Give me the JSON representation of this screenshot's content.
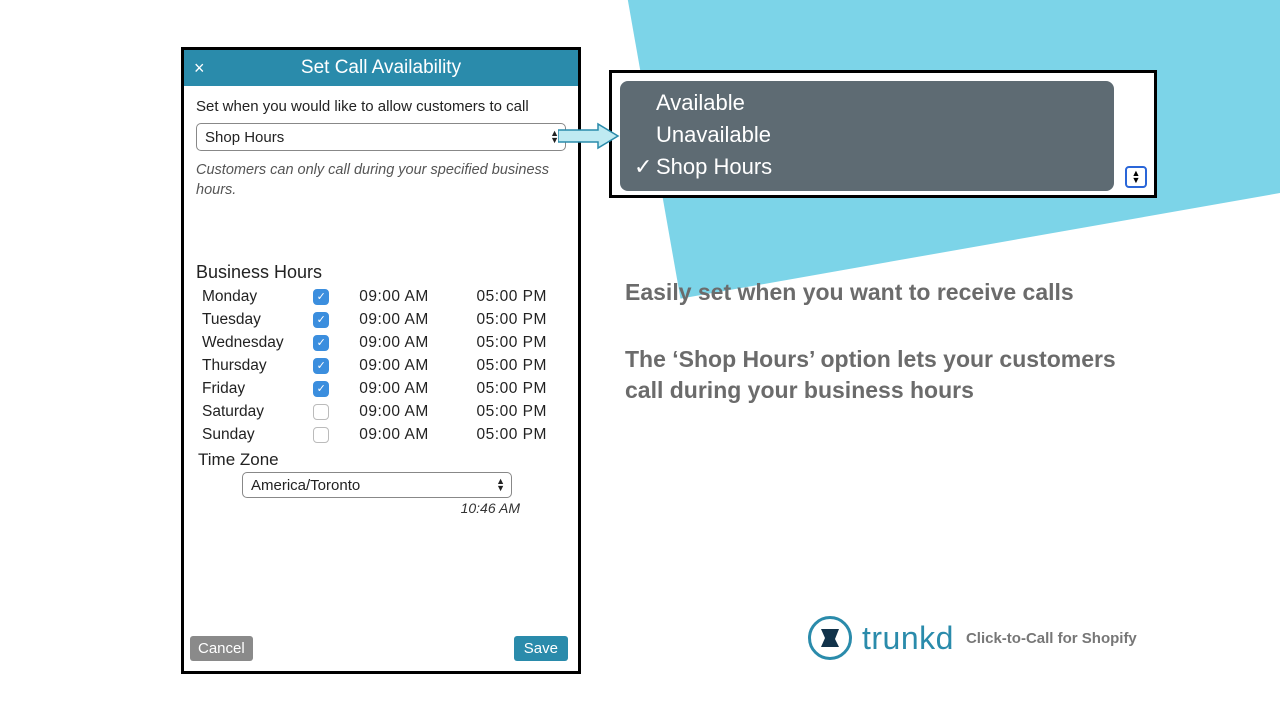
{
  "modal": {
    "title": "Set Call Availability",
    "close_glyph": "×",
    "instruction": "Set when you would like to allow customers to call",
    "availability_value": "Shop Hours",
    "helper": "Customers can only call during your specified business hours.",
    "business_hours_title": "Business Hours",
    "days": [
      {
        "name": "Monday",
        "enabled": true,
        "open": "09:00  AM",
        "close": "05:00  PM"
      },
      {
        "name": "Tuesday",
        "enabled": true,
        "open": "09:00  AM",
        "close": "05:00  PM"
      },
      {
        "name": "Wednesday",
        "enabled": true,
        "open": "09:00  AM",
        "close": "05:00  PM"
      },
      {
        "name": "Thursday",
        "enabled": true,
        "open": "09:00  AM",
        "close": "05:00  PM"
      },
      {
        "name": "Friday",
        "enabled": true,
        "open": "09:00  AM",
        "close": "05:00  PM"
      },
      {
        "name": "Saturday",
        "enabled": false,
        "open": "09:00  AM",
        "close": "05:00  PM"
      },
      {
        "name": "Sunday",
        "enabled": false,
        "open": "09:00  AM",
        "close": "05:00  PM"
      }
    ],
    "tz_title": "Time Zone",
    "tz_value": "America/Toronto",
    "tz_time": "10:46 AM",
    "cancel_label": "Cancel",
    "save_label": "Save"
  },
  "dropdown": {
    "options": [
      {
        "label": "Available",
        "selected": false
      },
      {
        "label": "Unavailable",
        "selected": false
      },
      {
        "label": "Shop Hours",
        "selected": true
      }
    ]
  },
  "marketing": {
    "line1": "Easily set when you want to receive calls",
    "line2": "The ‘Shop Hours’ option lets your customers call during your business hours"
  },
  "brand": {
    "name": "trunkd",
    "sub": "Click-to-Call for Shopify"
  },
  "glyphs": {
    "check": "✓"
  }
}
